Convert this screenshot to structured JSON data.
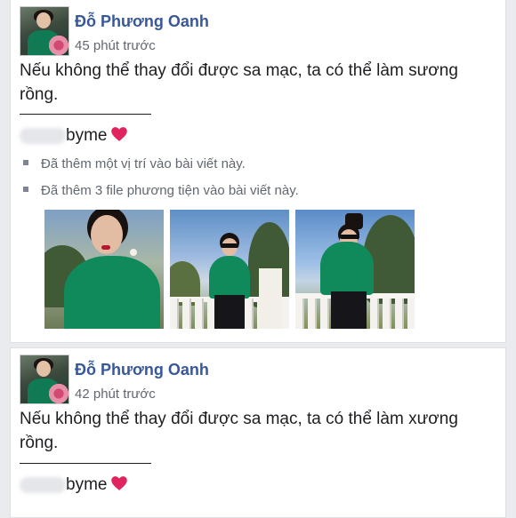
{
  "posts": [
    {
      "author": "Đỗ Phương Oanh",
      "time": "45 phút trước",
      "text": "Nếu không thể thay đổi được sa mạc, ta có thể làm sương rồng.",
      "tag": "byme",
      "activities": [
        "Đã thêm một vị trí vào bài viết này.",
        "Đã thêm 3 file phương tiện vào bài viết này."
      ],
      "photo_count": 3
    },
    {
      "author": "Đỗ Phương Oanh",
      "time": "42 phút trước",
      "text": "Nếu không thể thay đổi được sa mạc, ta có thể làm xương rồng.",
      "tag": "byme"
    }
  ],
  "icons": [
    "avatar",
    "heart-icon",
    "bullet-square-icon"
  ],
  "colors": {
    "author_name": "#385898",
    "meta_text": "#616770",
    "heart": "#e0245e",
    "page_bg": "#e9ebee"
  }
}
